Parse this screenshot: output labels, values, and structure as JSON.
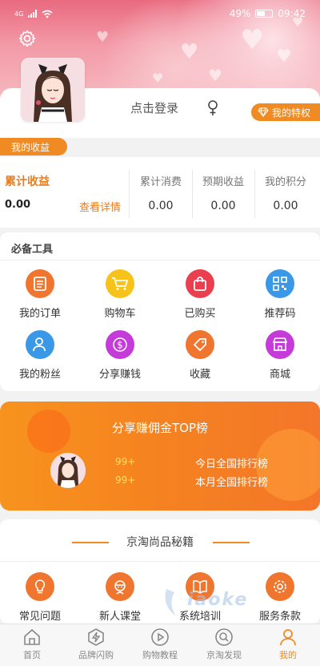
{
  "status": {
    "network": "4G",
    "battery": "49%",
    "time": "09:42"
  },
  "profile": {
    "login": "点击登录",
    "privilege": "我的特权"
  },
  "earnings": {
    "tag": "我的收益",
    "cumulative": {
      "label": "累计收益",
      "value": "0.00",
      "detail": "查看详情"
    },
    "columns": [
      {
        "label": "累计消费",
        "value": "0.00"
      },
      {
        "label": "预期收益",
        "value": "0.00"
      },
      {
        "label": "我的积分",
        "value": "0.00"
      }
    ]
  },
  "tools": {
    "title": "必备工具",
    "items": [
      {
        "label": "我的订单",
        "icon": "order-icon",
        "color": "#f0762f"
      },
      {
        "label": "购物车",
        "icon": "cart-icon",
        "color": "#f7c21a"
      },
      {
        "label": "已购买",
        "icon": "bag-icon",
        "color": "#ea3f4e"
      },
      {
        "label": "推荐码",
        "icon": "qrcode-icon",
        "color": "#3b98e6"
      },
      {
        "label": "我的粉丝",
        "icon": "fans-icon",
        "color": "#3b98e6"
      },
      {
        "label": "分享赚钱",
        "icon": "dollar-icon",
        "color": "#c43bd9"
      },
      {
        "label": "收藏",
        "icon": "tag-icon",
        "color": "#f0762f"
      },
      {
        "label": "商城",
        "icon": "store-icon",
        "color": "#c43bd9"
      }
    ]
  },
  "rank": {
    "title": "分享赚佣金TOP榜",
    "rows": [
      {
        "count": "99+",
        "label": "今日全国排行榜"
      },
      {
        "count": "99+",
        "label": "本月全国排行榜"
      }
    ]
  },
  "secrets": {
    "title": "京淘尚品秘籍",
    "items": [
      {
        "label": "常见问题",
        "icon": "bulb-icon"
      },
      {
        "label": "新人课堂",
        "icon": "person-icon"
      },
      {
        "label": "系统培训",
        "icon": "book-icon"
      },
      {
        "label": "服务条款",
        "icon": "settings-icon"
      }
    ]
  },
  "tabbar": {
    "items": [
      {
        "label": "首页",
        "icon": "home-icon",
        "active": false
      },
      {
        "label": "品牌闪购",
        "icon": "flash-icon",
        "active": false
      },
      {
        "label": "购物教程",
        "icon": "play-icon",
        "active": false
      },
      {
        "label": "京淘发现",
        "icon": "discover-icon",
        "active": false
      },
      {
        "label": "我的",
        "icon": "user-icon",
        "active": true
      }
    ]
  },
  "colors": {
    "accent": "#f08a23",
    "accent_text": "#e87d1e"
  }
}
